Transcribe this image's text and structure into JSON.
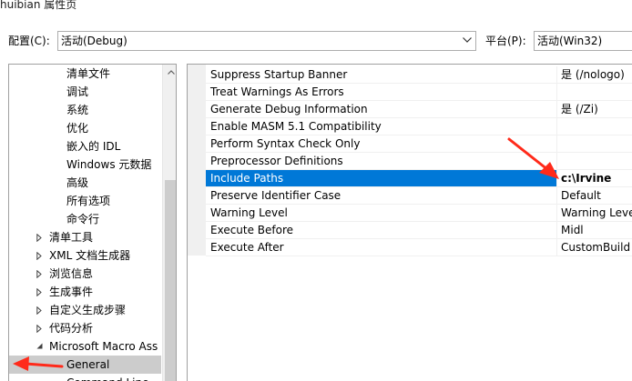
{
  "window": {
    "title": "huibian 属性页"
  },
  "config": {
    "label": "配置(C):",
    "value": "活动(Debug)"
  },
  "platform": {
    "label": "平台(P):",
    "value": "活动(Win32)"
  },
  "tree": {
    "items": [
      {
        "label": "清单文件",
        "indent": 2,
        "expander": "none"
      },
      {
        "label": "调试",
        "indent": 2,
        "expander": "none"
      },
      {
        "label": "系统",
        "indent": 2,
        "expander": "none"
      },
      {
        "label": "优化",
        "indent": 2,
        "expander": "none"
      },
      {
        "label": "嵌入的 IDL",
        "indent": 2,
        "expander": "none"
      },
      {
        "label": "Windows 元数据",
        "indent": 2,
        "expander": "none"
      },
      {
        "label": "高级",
        "indent": 2,
        "expander": "none"
      },
      {
        "label": "所有选项",
        "indent": 2,
        "expander": "none"
      },
      {
        "label": "命令行",
        "indent": 2,
        "expander": "none"
      },
      {
        "label": "清单工具",
        "indent": 1,
        "expander": "collapsed"
      },
      {
        "label": "XML 文档生成器",
        "indent": 1,
        "expander": "collapsed"
      },
      {
        "label": "浏览信息",
        "indent": 1,
        "expander": "collapsed"
      },
      {
        "label": "生成事件",
        "indent": 1,
        "expander": "collapsed"
      },
      {
        "label": "自定义生成步骤",
        "indent": 1,
        "expander": "collapsed"
      },
      {
        "label": "代码分析",
        "indent": 1,
        "expander": "collapsed"
      },
      {
        "label": "Microsoft Macro Ass",
        "indent": 1,
        "expander": "expanded"
      },
      {
        "label": "General",
        "indent": 2,
        "expander": "none",
        "selected": true
      },
      {
        "label": "Command Line",
        "indent": 2,
        "expander": "none"
      }
    ]
  },
  "properties": [
    {
      "name": "Suppress Startup Banner",
      "value": "是 (/nologo)"
    },
    {
      "name": "Treat Warnings As Errors",
      "value": ""
    },
    {
      "name": "Generate Debug Information",
      "value": "是 (/Zi)"
    },
    {
      "name": "Enable MASM 5.1 Compatibility",
      "value": ""
    },
    {
      "name": "Perform Syntax Check Only",
      "value": ""
    },
    {
      "name": "Preprocessor Definitions",
      "value": ""
    },
    {
      "name": "Include Paths",
      "value": "c:\\Irvine",
      "highlighted": true
    },
    {
      "name": "Preserve Identifier Case",
      "value": "Default"
    },
    {
      "name": "Warning Level",
      "value": "Warning Leve"
    },
    {
      "name": "Execute Before",
      "value": "Midl"
    },
    {
      "name": "Execute After",
      "value": "CustomBuild"
    }
  ],
  "colors": {
    "selection": "#0078d7",
    "annotation": "#ff2a1a"
  }
}
